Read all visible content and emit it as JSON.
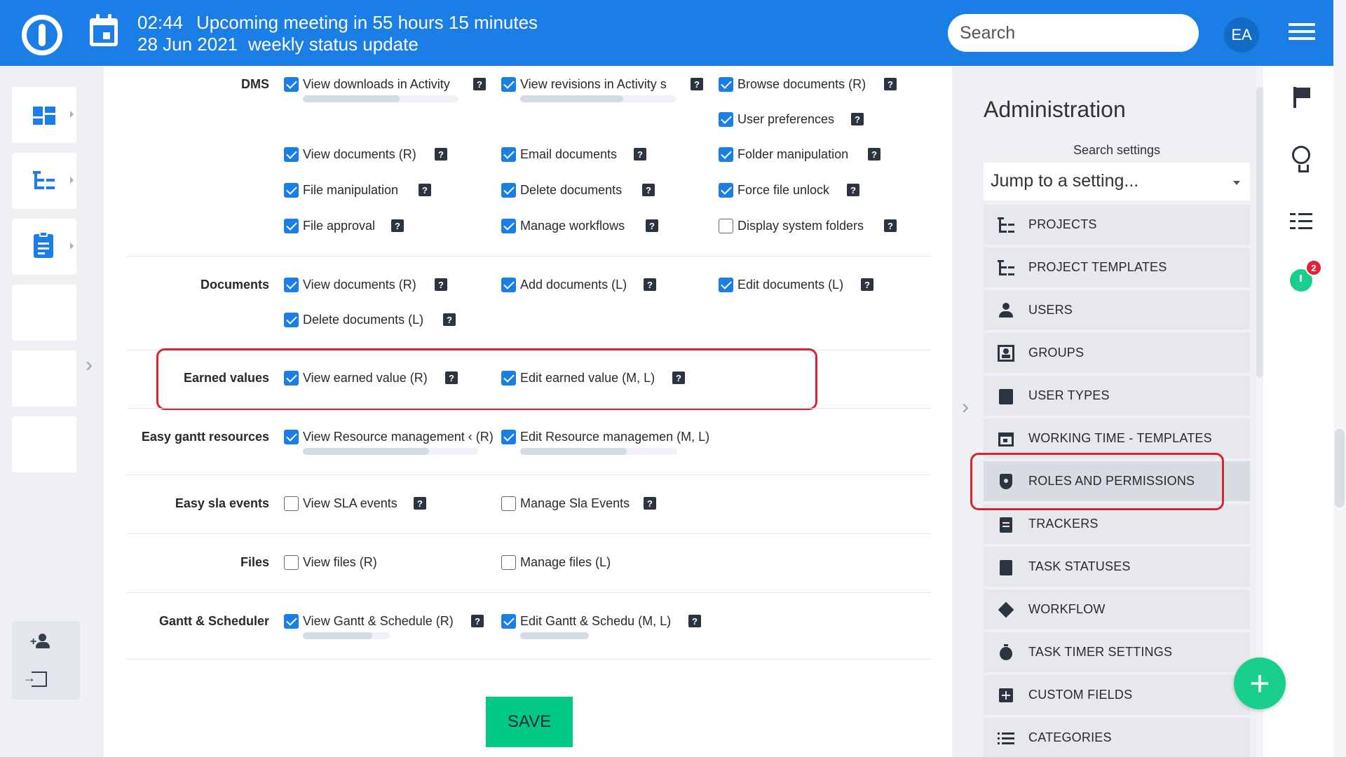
{
  "topbar": {
    "meeting_time": "02:44",
    "meeting_text": "Upcoming meeting in 55 hours 15 minutes",
    "meeting_date": "28 Jun 2021",
    "meeting_name": "weekly status update",
    "search_placeholder": "Search",
    "avatar_initials": "EA"
  },
  "permissions": {
    "dms": {
      "title": "DMS",
      "items": [
        {
          "label": "View downloads in Activity",
          "checked": true
        },
        {
          "label": "View revisions in Activity s",
          "checked": true
        },
        {
          "label": "Browse documents (R)",
          "checked": true
        },
        {
          "label": "User preferences",
          "checked": true
        },
        {
          "label": "View documents (R)",
          "checked": true
        },
        {
          "label": "Email documents",
          "checked": true
        },
        {
          "label": "Folder manipulation",
          "checked": true
        },
        {
          "label": "File manipulation",
          "checked": true
        },
        {
          "label": "Delete documents",
          "checked": true
        },
        {
          "label": "Force file unlock",
          "checked": true
        },
        {
          "label": "File approval",
          "checked": true
        },
        {
          "label": "Manage workflows",
          "checked": true
        },
        {
          "label": "Display system folders",
          "checked": false
        }
      ]
    },
    "documents": {
      "title": "Documents",
      "items": [
        {
          "label": "View documents (R)",
          "checked": true
        },
        {
          "label": "Add documents (L)",
          "checked": true
        },
        {
          "label": "Edit documents (L)",
          "checked": true
        },
        {
          "label": "Delete documents (L)",
          "checked": true
        }
      ]
    },
    "earned_values": {
      "title": "Earned values",
      "items": [
        {
          "label": "View earned value (R)",
          "checked": true
        },
        {
          "label": "Edit earned value (M, L)",
          "checked": true
        }
      ]
    },
    "gantt_resources": {
      "title": "Easy gantt resources",
      "items": [
        {
          "label": "View Resource management ‹ (R)",
          "checked": true
        },
        {
          "label": "Edit Resource managemen (M, L)",
          "checked": true
        }
      ]
    },
    "sla_events": {
      "title": "Easy sla events",
      "items": [
        {
          "label": "View SLA events",
          "checked": false
        },
        {
          "label": "Manage Sla Events",
          "checked": false
        }
      ]
    },
    "files": {
      "title": "Files",
      "items": [
        {
          "label": "View files (R)",
          "checked": false
        },
        {
          "label": "Manage files (L)",
          "checked": false
        }
      ]
    },
    "gantt_scheduler": {
      "title": "Gantt & Scheduler",
      "items": [
        {
          "label": "View Gantt & Schedule (R)",
          "checked": true
        },
        {
          "label": "Edit Gantt & Schedu (M, L)",
          "checked": true
        }
      ]
    },
    "help_glyph": "?"
  },
  "save_label": "SAVE",
  "admin": {
    "title": "Administration",
    "search_label": "Search settings",
    "jump_placeholder": "Jump to a setting...",
    "menu": [
      {
        "label": "PROJECTS",
        "icon": "project-tree-icon"
      },
      {
        "label": "PROJECT TEMPLATES",
        "icon": "project-tree-icon"
      },
      {
        "label": "USERS",
        "icon": "user-icon"
      },
      {
        "label": "GROUPS",
        "icon": "group-icon"
      },
      {
        "label": "USER TYPES",
        "icon": "user-badge-icon"
      },
      {
        "label": "WORKING TIME - TEMPLATES",
        "icon": "calendar-icon"
      },
      {
        "label": "ROLES AND PERMISSIONS",
        "icon": "shield-icon",
        "active": true
      },
      {
        "label": "TRACKERS",
        "icon": "clipboard-icon"
      },
      {
        "label": "TASK STATUSES",
        "icon": "clipboard-check-icon"
      },
      {
        "label": "WORKFLOW",
        "icon": "diamond-arrow-icon"
      },
      {
        "label": "TASK TIMER SETTINGS",
        "icon": "stopwatch-icon"
      },
      {
        "label": "CUSTOM FIELDS",
        "icon": "plus-square-icon"
      },
      {
        "label": "CATEGORIES",
        "icon": "list-icon"
      }
    ]
  },
  "rail": {
    "timer_badge": "2"
  },
  "colors": {
    "topbar": "#1a7ee6",
    "checkbox": "#1a7ee6",
    "save": "#00c986",
    "highlight": "#d8242f",
    "fab": "#19cf8c"
  }
}
